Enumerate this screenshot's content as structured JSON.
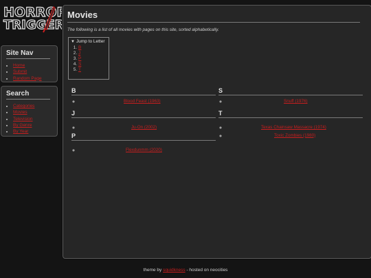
{
  "logo": {
    "line1": "HORROR",
    "line2": "TRIGGER"
  },
  "site_nav": {
    "title": "Site Nav",
    "items": [
      "Home",
      "Submit",
      "Random Page"
    ]
  },
  "search": {
    "title": "Search",
    "items": [
      "Categories",
      "Movies",
      "Television",
      "By Genre",
      "By Year"
    ]
  },
  "main": {
    "title": "Movies",
    "intro": "The following is a list of all movies with pages on this site, sorted alphabetically.",
    "jump": {
      "label": "Jump to Letter",
      "letters": [
        "B",
        "J",
        "P",
        "S",
        "T"
      ]
    },
    "sections": {
      "B": {
        "letter": "B",
        "movies": [
          "Blood Feast (1963)"
        ]
      },
      "J": {
        "letter": "J",
        "movies": [
          "Ju-On (2002)"
        ]
      },
      "P": {
        "letter": "P",
        "movies": [
          "Flexdunmm (2020)"
        ]
      },
      "S": {
        "letter": "S",
        "movies": [
          "Snuff (1976)"
        ]
      },
      "T": {
        "letter": "T",
        "movies": [
          "Texas Chainsaw Massacre (1974)",
          "Toxic Zombies (1980)"
        ]
      }
    }
  },
  "footer": {
    "prefix": "theme by ",
    "author": "squidkness",
    "suffix": " - hosted on neocities"
  },
  "colors": {
    "link": "#c81e1e",
    "background": "#141414",
    "panel": "#262626"
  }
}
